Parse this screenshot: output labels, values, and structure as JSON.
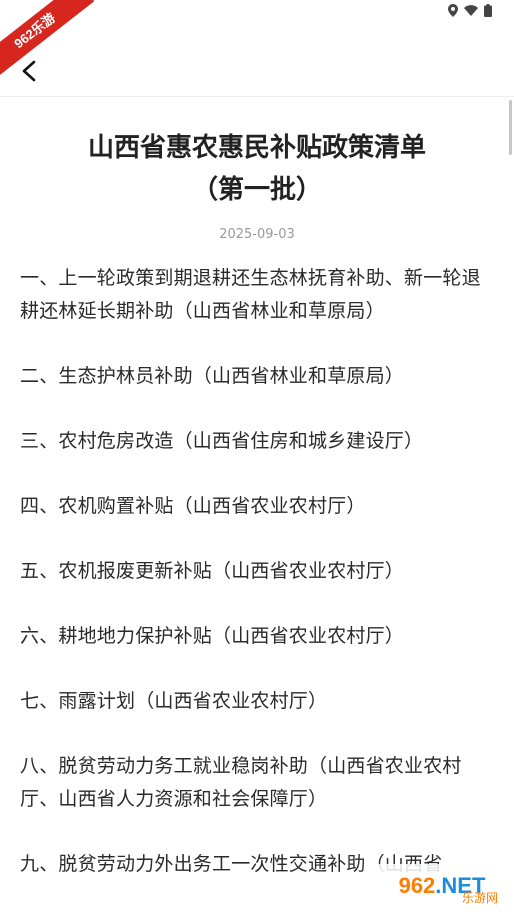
{
  "badge": "962乐游",
  "status_icons": [
    "location-icon",
    "wifi-icon",
    "battery-icon"
  ],
  "article": {
    "title": "山西省惠农惠民补贴政策清单（第一批）",
    "date": "2025-09-03",
    "items": [
      "一、上一轮政策到期退耕还生态林抚育补助、新一轮退耕还林延长期补助（山西省林业和草原局）",
      "二、生态护林员补助（山西省林业和草原局）",
      "三、农村危房改造（山西省住房和城乡建设厅）",
      "四、农机购置补贴（山西省农业农村厅）",
      "五、农机报废更新补贴（山西省农业农村厅）",
      "六、耕地地力保护补贴（山西省农业农村厅）",
      "七、雨露计划（山西省农业农村厅）",
      "八、脱贫劳动力务工就业稳岗补助（山西省农业农村厅、山西省人力资源和社会保障厅）",
      "九、脱贫劳动力外出务工一次性交通补助（山西省"
    ]
  },
  "watermark": {
    "logo": "962",
    "logo_suffix": ".NET",
    "sub": "乐游网"
  },
  "colors": {
    "ribbon": "#d7261e",
    "watermark_orange": "#ff7d00",
    "watermark_blue": "#1a8de0"
  }
}
